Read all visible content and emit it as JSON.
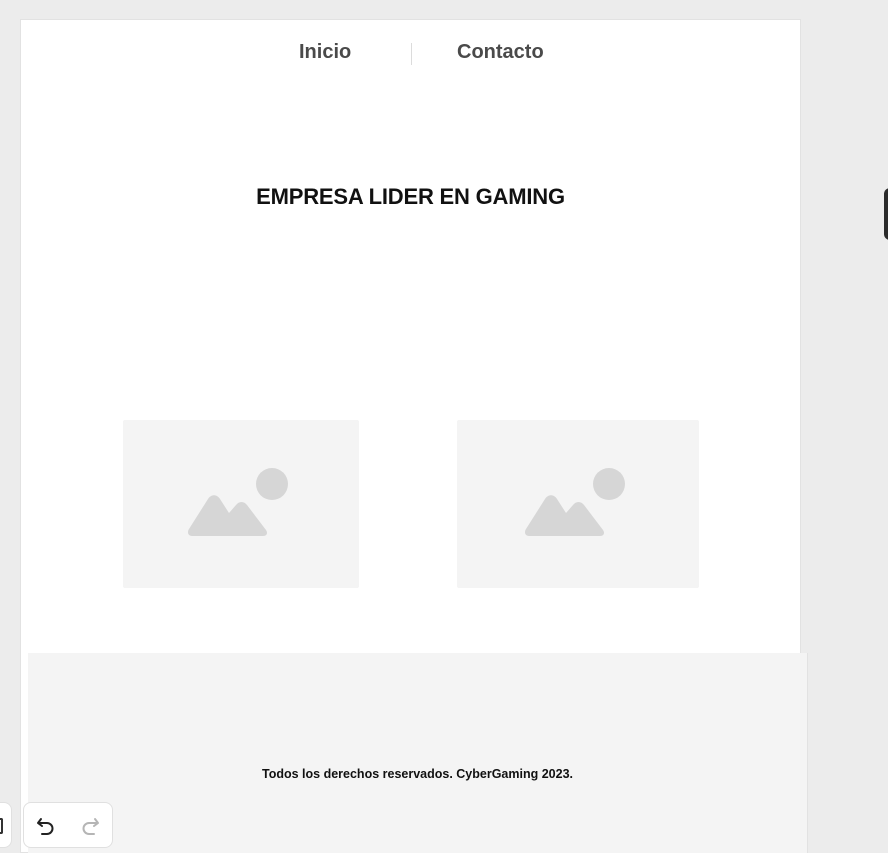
{
  "nav": {
    "items": [
      {
        "label": "Inicio"
      },
      {
        "label": "Contacto"
      }
    ]
  },
  "hero": {
    "title": "EMPRESA LIDER EN GAMING"
  },
  "media": {
    "placeholders": [
      {
        "icon": "image-placeholder-icon"
      },
      {
        "icon": "image-placeholder-icon"
      }
    ]
  },
  "footer": {
    "text": "Todos los derechos reservados. CyberGaming 2023."
  },
  "toolbar": {
    "undo_icon": "undo-icon",
    "redo_icon": "redo-icon",
    "redo_enabled": false
  },
  "colors": {
    "background": "#ececec",
    "canvas": "#ffffff",
    "placeholder": "#f4f4f4",
    "placeholder_icon": "#d6d6d6",
    "nav_text": "#4a4a4a",
    "title_text": "#111111"
  }
}
